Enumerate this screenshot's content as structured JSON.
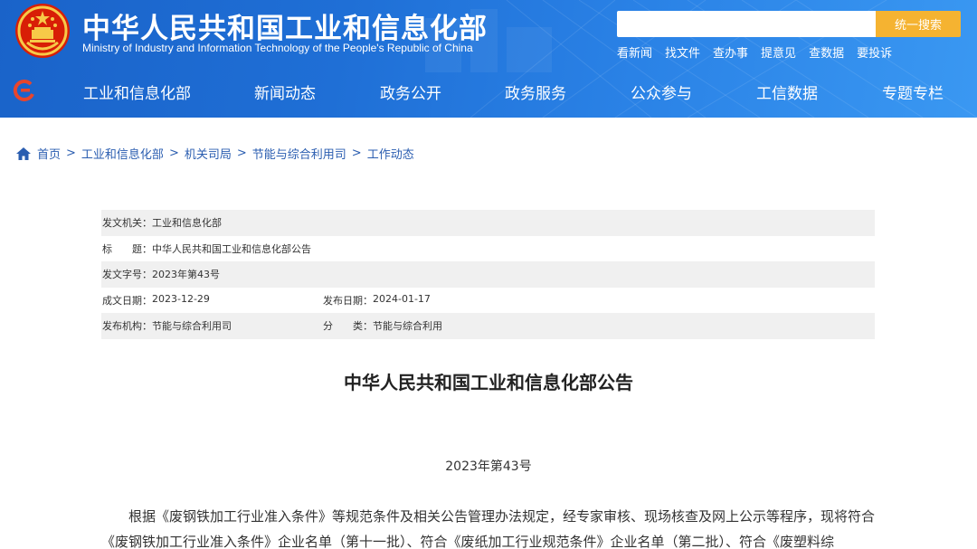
{
  "header": {
    "title_cn": "中华人民共和国工业和信息化部",
    "title_en": "Ministry of Industry and Information Technology of the People's Republic of China",
    "search": {
      "placeholder": "",
      "button_label": "统一搜索"
    },
    "quick_links": [
      "看新闻",
      "找文件",
      "查办事",
      "提意见",
      "查数据",
      "要投诉"
    ]
  },
  "nav": {
    "items": [
      "工业和信息化部",
      "新闻动态",
      "政务公开",
      "政务服务",
      "公众参与",
      "工信数据",
      "专题专栏"
    ]
  },
  "breadcrumb": {
    "items": [
      "首页",
      "工业和信息化部",
      "机关司局",
      "节能与综合利用司",
      "工作动态"
    ],
    "separator": ">"
  },
  "meta": {
    "issuer_label": "发文机关：",
    "issuer": "工业和信息化部",
    "title_label": "标　　题：",
    "title": "中华人民共和国工业和信息化部公告",
    "doc_no_label": "发文字号：",
    "doc_no": "2023年第43号",
    "created_label": "成文日期：",
    "created": "2023-12-29",
    "published_label": "发布日期：",
    "published": "2024-01-17",
    "org_label": "发布机构：",
    "org": "节能与综合利用司",
    "category_label": "分　　类：",
    "category": "节能与综合利用"
  },
  "article": {
    "title": "中华人民共和国工业和信息化部公告",
    "number": "2023年第43号",
    "body": "根据《废钢铁加工行业准入条件》等规范条件及相关公告管理办法规定，经专家审核、现场核查及网上公示等程序，现将符合《废钢铁加工行业准入条件》企业名单（第十一批）、符合《废纸加工行业规范条件》企业名单（第二批）、符合《废塑料综"
  },
  "colors": {
    "header_blue": "#1f6fd6",
    "search_button": "#f5b331",
    "link_blue": "#2a5db0",
    "shade_gray": "#f0f0f0"
  },
  "icons": {
    "emblem": "national-emblem-icon",
    "nav_logo": "miit-logo-icon",
    "home": "home-icon"
  }
}
